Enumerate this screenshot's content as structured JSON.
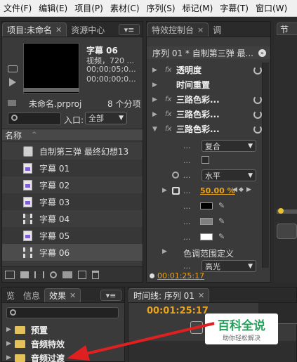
{
  "menu": [
    "文件(F)",
    "编辑(E)",
    "项目(P)",
    "素材(C)",
    "序列(S)",
    "标记(M)",
    "字幕(T)",
    "窗口(W)"
  ],
  "project_panel": {
    "tab_project": "项目:未命名",
    "tab_media": "资源中心",
    "preview": {
      "title": "字幕 06",
      "line1": "视频，720 ...",
      "line2": "00;00;05;0...",
      "line3": "00;00;00;0..."
    },
    "project_file": "未命名.prproj",
    "item_count": "8 个分项",
    "entry_label": "入口:",
    "entry_value": "全部",
    "column_name": "名称",
    "items": [
      {
        "type": "audio",
        "label": "自制第三弹 最终幻想13"
      },
      {
        "type": "title",
        "label": "字幕 01"
      },
      {
        "type": "title",
        "label": "字幕 02"
      },
      {
        "type": "title",
        "label": "字幕 03"
      },
      {
        "type": "film",
        "label": "字幕 04"
      },
      {
        "type": "title",
        "label": "字幕 05"
      },
      {
        "type": "film",
        "label": "字幕 06"
      }
    ]
  },
  "effects_panel": {
    "tab": "特效控制台",
    "tab_close": "×",
    "tab2": "调",
    "sequence": "序列 01 * 自制第三弹 最...",
    "rows": [
      {
        "fx": "fx",
        "label": "透明度"
      },
      {
        "fx": "",
        "label": "时间重置"
      },
      {
        "fx": "fx",
        "label": "三路色彩..."
      },
      {
        "fx": "fx",
        "label": "三路色彩..."
      },
      {
        "fx": "fx",
        "label": "三路色彩..."
      }
    ],
    "blend_mode": "复合",
    "direction": "水平",
    "percent": "50.00 %",
    "color_range": "色调范围定义",
    "highlight": "高光",
    "timecode": "00:01:25:17"
  },
  "bottom_left": {
    "tabs": [
      "览",
      "信息",
      "效果"
    ],
    "folders": [
      "预置",
      "音频特效",
      "音频过渡"
    ]
  },
  "timeline": {
    "tab": "时间线: 序列 01",
    "timecode": "00:01:25:17"
  },
  "program": {
    "tab": "节"
  },
  "watermark": {
    "title": "百科全说",
    "subtitle": "助你轻松解决"
  },
  "colors": {
    "accent_orange": "#e8a21c",
    "panel_bg": "#3a3a3a",
    "arrow_red": "#e02020"
  }
}
